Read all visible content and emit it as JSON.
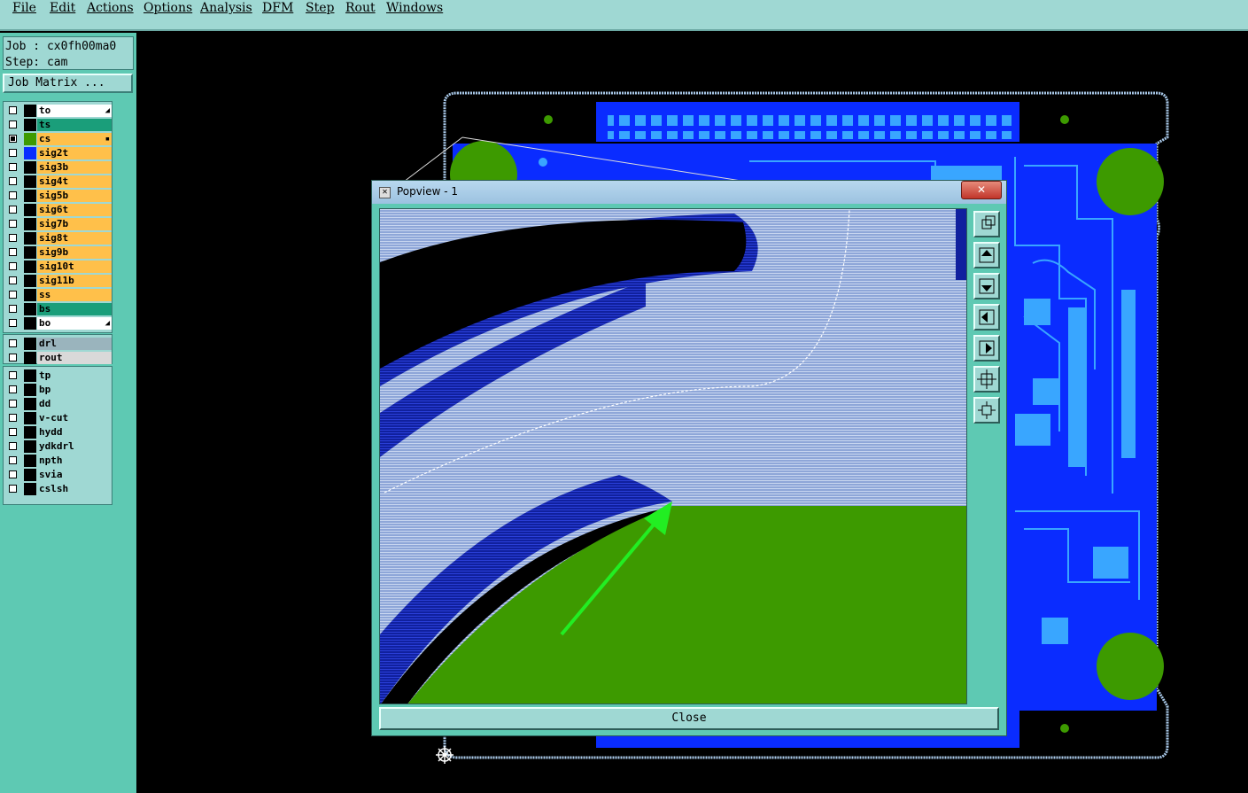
{
  "menu": {
    "items": [
      {
        "label": "File"
      },
      {
        "label": "Edit"
      },
      {
        "label": "Actions"
      },
      {
        "label": "Options"
      },
      {
        "label": "Analysis"
      },
      {
        "label": "DFM"
      },
      {
        "label": "Step"
      },
      {
        "label": "Rout"
      },
      {
        "label": "Windows"
      }
    ]
  },
  "job": {
    "job_line": "Job : cx0fh00ma0",
    "step_line": "Step: cam",
    "matrix_button": "Job Matrix ..."
  },
  "layers_group1": [
    {
      "name": "to",
      "color": "#ffffff",
      "swatch": "#000000",
      "mark": "◢"
    },
    {
      "name": "ts",
      "color": "#1a9e7a",
      "swatch": "#000000",
      "mark": ""
    },
    {
      "name": "cs",
      "color": "#ffc04a",
      "swatch": "#3d9a00",
      "mark": "▪",
      "checked": true
    },
    {
      "name": "sig2t",
      "color": "#ffc04a",
      "swatch": "#0a2cff",
      "mark": ""
    },
    {
      "name": "sig3b",
      "color": "#ffc04a",
      "swatch": "#000000",
      "mark": ""
    },
    {
      "name": "sig4t",
      "color": "#ffc04a",
      "swatch": "#000000",
      "mark": ""
    },
    {
      "name": "sig5b",
      "color": "#ffc04a",
      "swatch": "#000000",
      "mark": ""
    },
    {
      "name": "sig6t",
      "color": "#ffc04a",
      "swatch": "#000000",
      "mark": ""
    },
    {
      "name": "sig7b",
      "color": "#ffc04a",
      "swatch": "#000000",
      "mark": ""
    },
    {
      "name": "sig8t",
      "color": "#ffc04a",
      "swatch": "#000000",
      "mark": ""
    },
    {
      "name": "sig9b",
      "color": "#ffc04a",
      "swatch": "#000000",
      "mark": ""
    },
    {
      "name": "sig10t",
      "color": "#ffc04a",
      "swatch": "#000000",
      "mark": ""
    },
    {
      "name": "sig11b",
      "color": "#ffc04a",
      "swatch": "#000000",
      "mark": ""
    },
    {
      "name": "ss",
      "color": "#ffc04a",
      "swatch": "#000000",
      "mark": ""
    },
    {
      "name": "bs",
      "color": "#1a9e7a",
      "swatch": "#000000",
      "mark": ""
    },
    {
      "name": "bo",
      "color": "#ffffff",
      "swatch": "#000000",
      "mark": "◢"
    }
  ],
  "layers_group2": [
    {
      "name": "drl",
      "color": "#9ab4bd",
      "swatch": "#000000"
    },
    {
      "name": "rout",
      "color": "#d9d9d9",
      "swatch": "#000000"
    }
  ],
  "layers_group3": [
    {
      "name": "tp",
      "color": "#9fd8d3",
      "swatch": "#000000"
    },
    {
      "name": "bp",
      "color": "#9fd8d3",
      "swatch": "#000000"
    },
    {
      "name": "dd",
      "color": "#9fd8d3",
      "swatch": "#000000"
    },
    {
      "name": "v-cut",
      "color": "#9fd8d3",
      "swatch": "#000000"
    },
    {
      "name": "hydd",
      "color": "#9fd8d3",
      "swatch": "#000000"
    },
    {
      "name": "ydkdrl",
      "color": "#9fd8d3",
      "swatch": "#000000"
    },
    {
      "name": "npth",
      "color": "#9fd8d3",
      "swatch": "#000000"
    },
    {
      "name": "svia",
      "color": "#9fd8d3",
      "swatch": "#000000"
    },
    {
      "name": "cslsh",
      "color": "#9fd8d3",
      "swatch": "#000000"
    }
  ],
  "popview": {
    "title": "Popview - 1",
    "close_x": "✕",
    "close_button": "Close",
    "tools": [
      "zoom-fit-icon",
      "pan-up-icon",
      "pan-down-icon",
      "pan-left-icon",
      "pan-right-icon",
      "zoom-in-icon",
      "zoom-out-icon"
    ]
  },
  "colors": {
    "board_blue": "#0a2cff",
    "copper_green": "#3d9a00",
    "pad_light": "#39a6ff",
    "outline": "#a8c8e8",
    "arrow": "#22ee22",
    "panel": "#5ec9b3",
    "menubar": "#9fd8d3"
  }
}
